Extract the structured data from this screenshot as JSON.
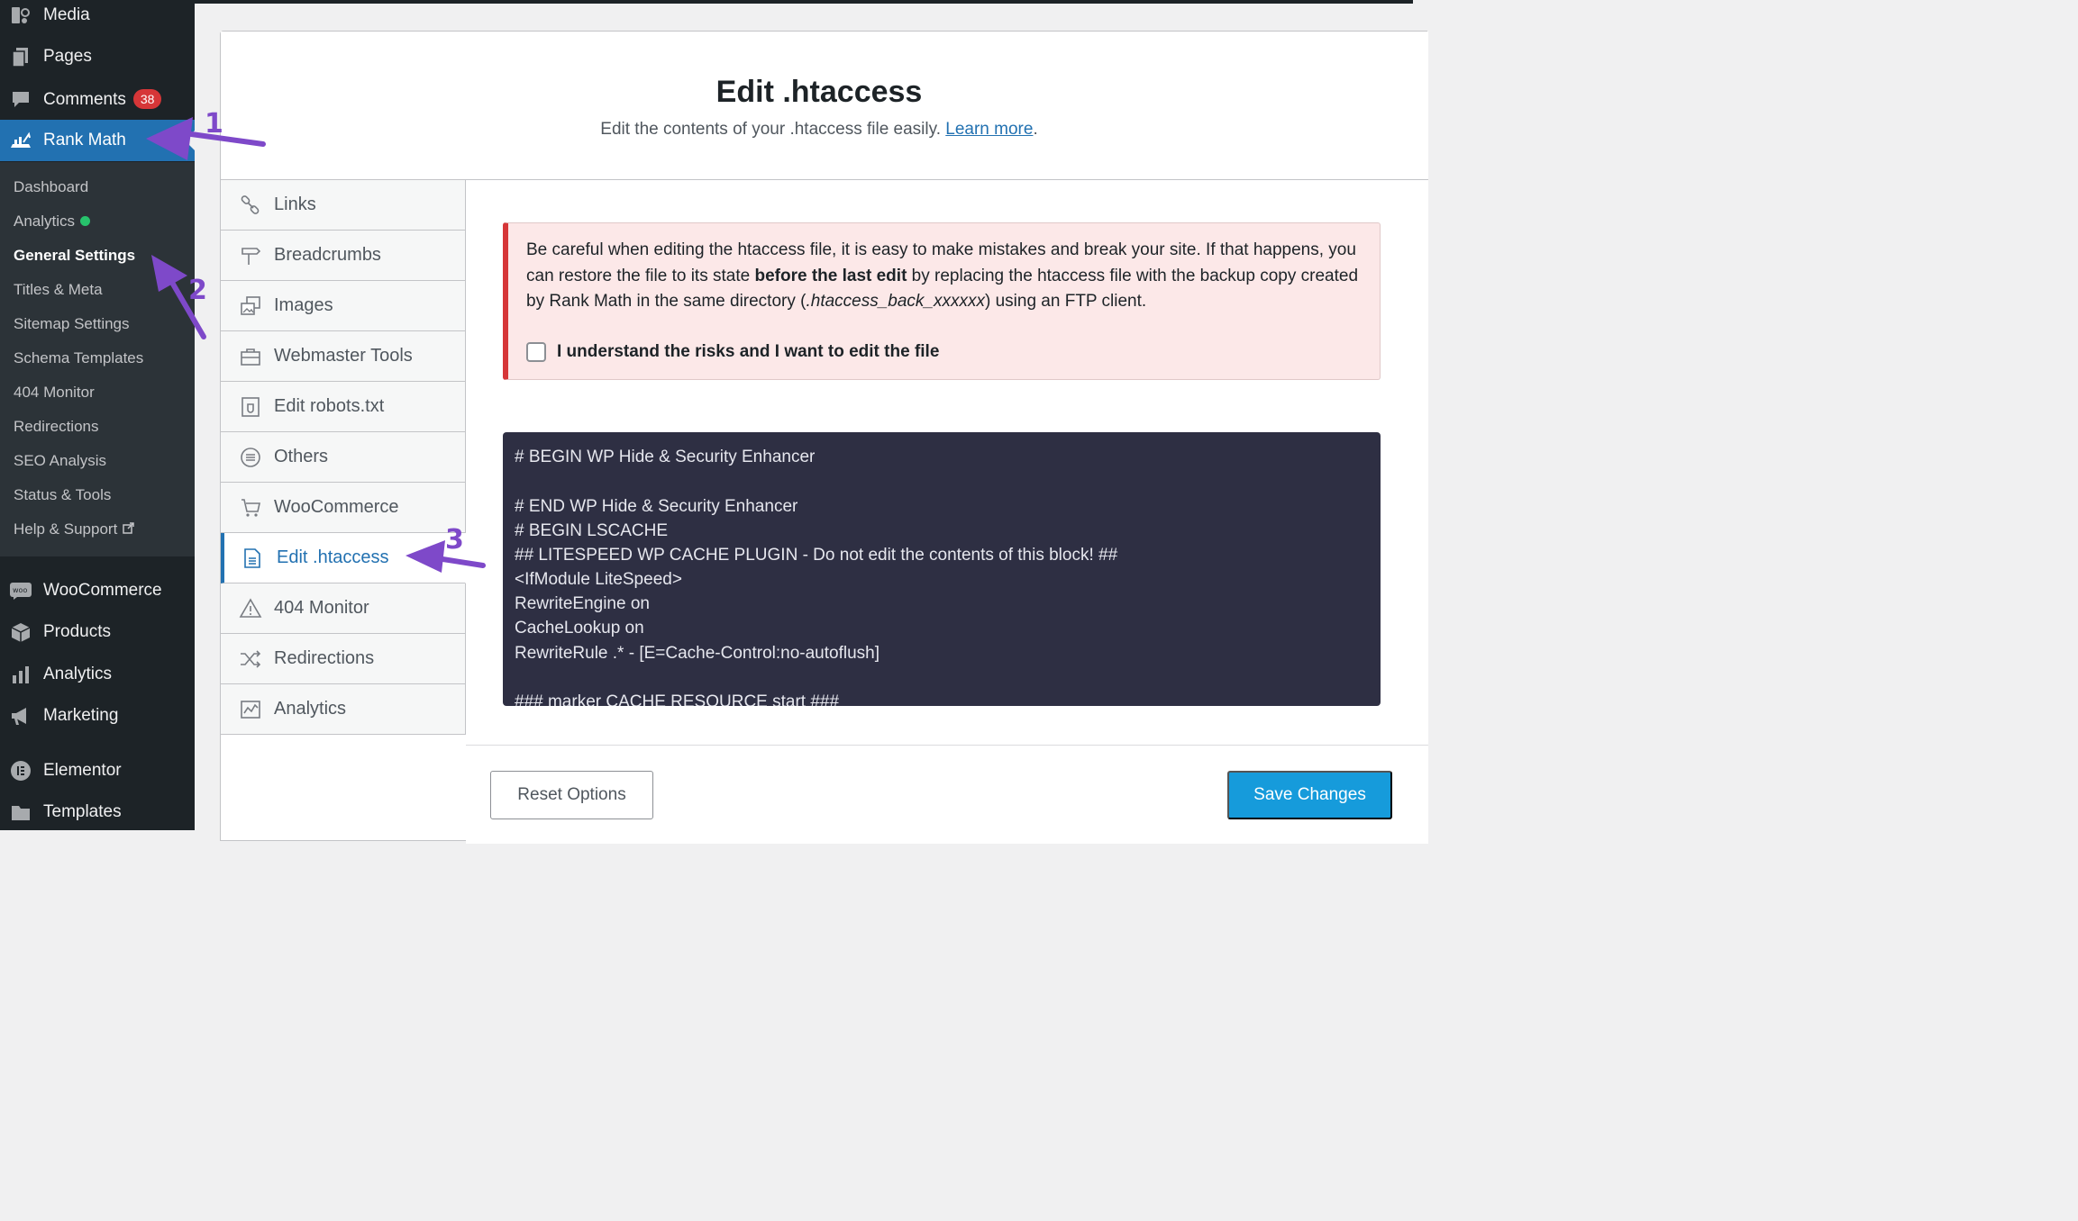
{
  "sidebar": {
    "top_items": [
      {
        "label": "Media",
        "icon": "media-icon"
      },
      {
        "label": "Pages",
        "icon": "pages-icon"
      },
      {
        "label": "Comments",
        "icon": "comments-icon",
        "badge": "38"
      },
      {
        "label": "Rank Math",
        "icon": "rank-math-icon",
        "active": true
      }
    ],
    "submenu": [
      {
        "label": "Dashboard"
      },
      {
        "label": "Analytics",
        "status": "green"
      },
      {
        "label": "General Settings",
        "current": true
      },
      {
        "label": "Titles & Meta"
      },
      {
        "label": "Sitemap Settings"
      },
      {
        "label": "Schema Templates"
      },
      {
        "label": "404 Monitor"
      },
      {
        "label": "Redirections"
      },
      {
        "label": "SEO Analysis"
      },
      {
        "label": "Status & Tools"
      },
      {
        "label": "Help & Support",
        "external": true
      }
    ],
    "bottom_items": [
      {
        "label": "WooCommerce",
        "icon": "woocommerce-icon"
      },
      {
        "label": "Products",
        "icon": "products-icon"
      },
      {
        "label": "Analytics",
        "icon": "analytics-icon"
      },
      {
        "label": "Marketing",
        "icon": "megaphone-icon"
      },
      {
        "label": "Elementor",
        "icon": "elementor-icon"
      },
      {
        "label": "Templates",
        "icon": "folder-icon"
      }
    ]
  },
  "header": {
    "title": "Edit .htaccess",
    "description": "Edit the contents of your .htaccess file easily.",
    "learn_more": "Learn more",
    "period": "."
  },
  "tabs": [
    {
      "label": "Links",
      "icon": "link-icon"
    },
    {
      "label": "Breadcrumbs",
      "icon": "signpost-icon"
    },
    {
      "label": "Images",
      "icon": "images-icon"
    },
    {
      "label": "Webmaster Tools",
      "icon": "toolbox-icon"
    },
    {
      "label": "Edit robots.txt",
      "icon": "robot-file-icon"
    },
    {
      "label": "Others",
      "icon": "list-circle-icon"
    },
    {
      "label": "WooCommerce",
      "icon": "cart-icon"
    },
    {
      "label": "Edit .htaccess",
      "icon": "file-icon",
      "active": true
    },
    {
      "label": "404 Monitor",
      "icon": "warning-icon"
    },
    {
      "label": "Redirections",
      "icon": "shuffle-icon"
    },
    {
      "label": "Analytics",
      "icon": "chart-icon"
    }
  ],
  "notice": {
    "text_1": "Be careful when editing the htaccess file, it is easy to make mistakes and break your site. If that happens, you can restore the file to its state ",
    "text_bold": "before the last edit",
    "text_2": " by replacing the htaccess file with the backup copy created by Rank Math in the same directory (",
    "text_italic": ".htaccess_back_xxxxxx",
    "text_3": ") using an FTP client.",
    "checkbox_label": "I understand the risks and I want to edit the file",
    "checked": false
  },
  "code_lines": [
    "# BEGIN WP Hide & Security Enhancer",
    "",
    "# END WP Hide & Security Enhancer",
    "# BEGIN LSCACHE",
    "## LITESPEED WP CACHE PLUGIN - Do not edit the contents of this block! ##",
    "<IfModule LiteSpeed>",
    "RewriteEngine on",
    "CacheLookup on",
    "RewriteRule .* - [E=Cache-Control:no-autoflush]",
    "",
    "### marker CACHE RESOURCE start ###"
  ],
  "footer": {
    "reset_label": "Reset Options",
    "save_label": "Save Changes"
  },
  "annotations": [
    "1",
    "2",
    "3"
  ],
  "colors": {
    "sidebar_bg": "#1d2327",
    "submenu_bg": "#2c3338",
    "accent": "#2271b1",
    "save_button": "#169bdb",
    "badge": "#d63638",
    "notice_bg": "#fce8e8",
    "code_bg": "#2e2f43",
    "annotation": "#7e49c9"
  }
}
